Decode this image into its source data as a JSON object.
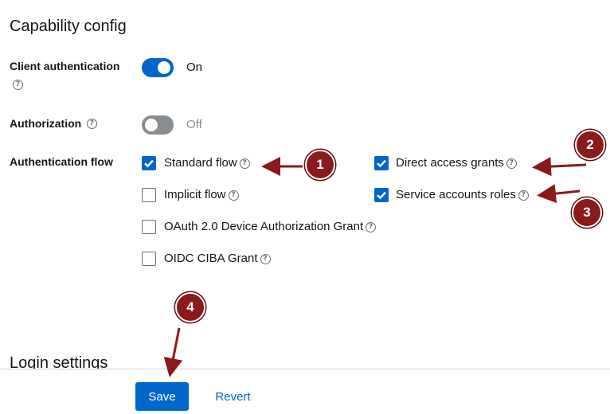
{
  "capability": {
    "title": "Capability config",
    "client_auth": {
      "label": "Client authentication",
      "state": "On",
      "on": true
    },
    "authorization": {
      "label": "Authorization",
      "state": "Off",
      "on": false
    },
    "auth_flow": {
      "label": "Authentication flow",
      "options": [
        {
          "label": "Standard flow",
          "checked": true
        },
        {
          "label": "Direct access grants",
          "checked": true
        },
        {
          "label": "Implicit flow",
          "checked": false
        },
        {
          "label": "Service accounts roles",
          "checked": true
        },
        {
          "label": "OAuth 2.0 Device Authorization Grant",
          "checked": false
        },
        {
          "label": "OIDC CIBA Grant",
          "checked": false
        }
      ]
    }
  },
  "login_settings": {
    "title": "Login settings"
  },
  "footer": {
    "save_label": "Save",
    "revert_label": "Revert"
  },
  "annotations": [
    "1",
    "2",
    "3",
    "4"
  ],
  "colors": {
    "accent": "#0066cc",
    "toggle_off": "#8a8d90",
    "annotation": "#8b1a1a"
  },
  "icons": {
    "help": "help-circle-icon",
    "check": "check-icon"
  }
}
